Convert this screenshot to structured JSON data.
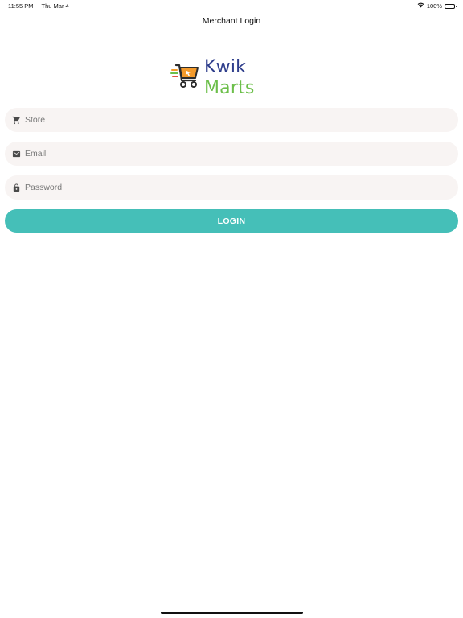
{
  "status_bar": {
    "time": "11:55 PM",
    "date": "Thu Mar 4",
    "battery_percent": "100%",
    "wifi_icon": "wifi-icon",
    "battery_icon": "battery-icon"
  },
  "nav": {
    "title": "Merchant Login"
  },
  "logo": {
    "word1": "Kwik",
    "word2": "Marts",
    "icon": "shopping-cart-logo",
    "colors": {
      "kwik": "#2f3e8c",
      "marts": "#6cbf4a",
      "cart_orange": "#f39a2b"
    }
  },
  "form": {
    "store": {
      "placeholder": "Store",
      "value": "",
      "icon": "cart-icon"
    },
    "email": {
      "placeholder": "Email",
      "value": "",
      "icon": "mail-icon"
    },
    "password": {
      "placeholder": "Password",
      "value": "",
      "icon": "lock-icon"
    },
    "login_label": "LOGIN",
    "accent": "#45bfb8",
    "field_background": "#f8f4f3"
  }
}
